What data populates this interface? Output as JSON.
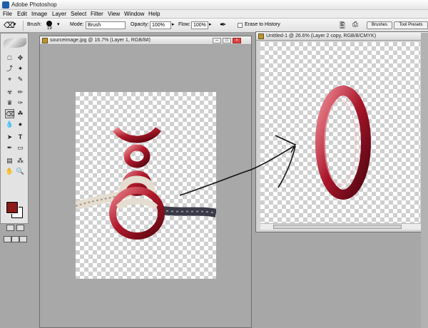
{
  "app": {
    "title": "Adobe Photoshop"
  },
  "menu": [
    "File",
    "Edit",
    "Image",
    "Layer",
    "Select",
    "Filter",
    "View",
    "Window",
    "Help"
  ],
  "options": {
    "brush_label": "Brush:",
    "brush_size": "19",
    "mode_label": "Mode:",
    "mode_value": "Brush",
    "opacity_label": "Opacity:",
    "opacity_value": "100%",
    "flow_label": "Flow:",
    "flow_value": "100%",
    "erase_history_label": "Erase to History"
  },
  "panel_tabs": {
    "brushes": "Brushes",
    "tool_presets": "Tool Presets"
  },
  "windows": {
    "source": {
      "title": "sourceimage.jpg @ 16.7% (Layer 1, RGB/8#)"
    },
    "untitled": {
      "title": "Untitled-1 @ 26.6% (Layer 2 copy, RGB/8/CMYK)"
    }
  },
  "colors": {
    "foreground": "#8b1a1a",
    "background": "#ffffff",
    "ring": "#a0192a"
  }
}
